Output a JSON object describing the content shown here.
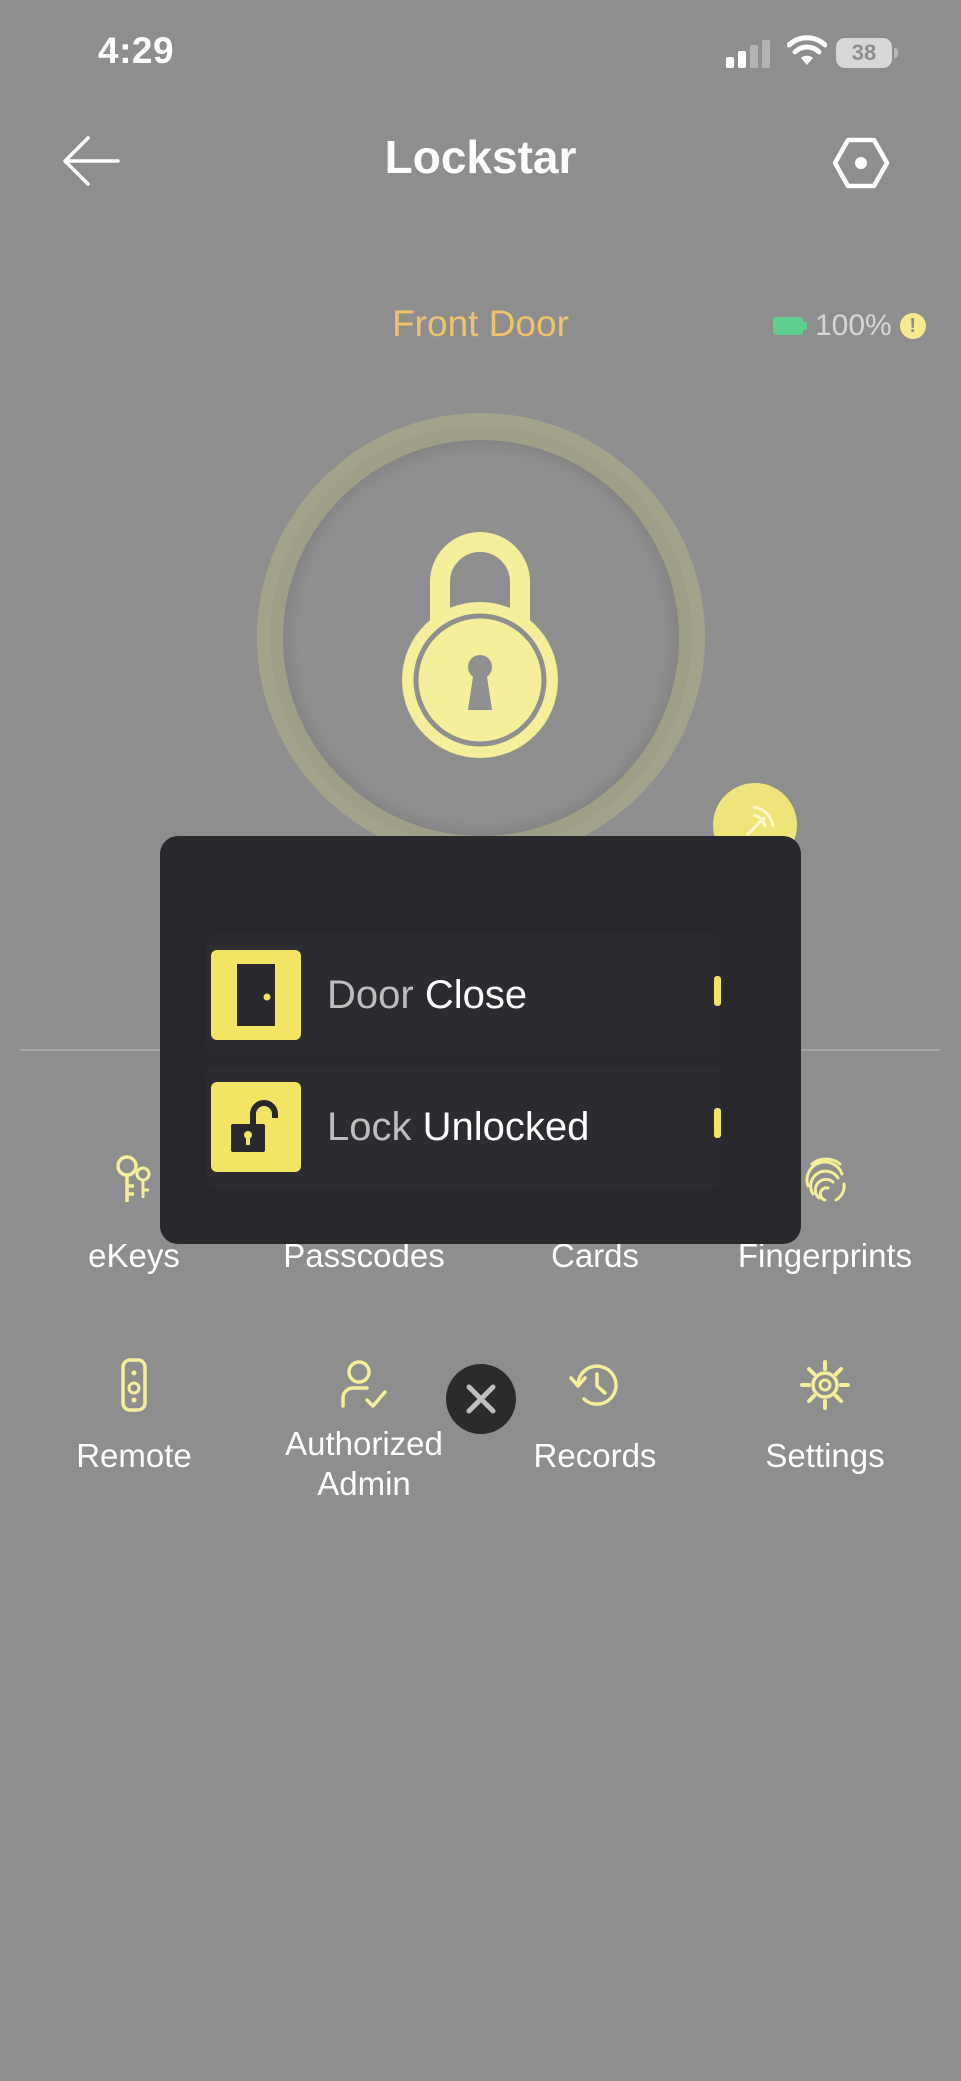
{
  "status_bar": {
    "time": "4:29",
    "battery_level": "38"
  },
  "nav": {
    "title": "Lockstar"
  },
  "lock": {
    "name": "Front Door",
    "battery_percent": "100%",
    "battery_warning": "!"
  },
  "popup": {
    "rows": [
      {
        "key": "Door",
        "value": "Close"
      },
      {
        "key": "Lock",
        "value": "Unlocked"
      }
    ]
  },
  "menu": {
    "row1": [
      {
        "label": "eKeys",
        "icon": "keys-icon"
      },
      {
        "label": "Passcodes",
        "icon": "passcode-icon"
      },
      {
        "label": "Cards",
        "icon": "card-icon"
      },
      {
        "label": "Fingerprints",
        "icon": "fingerprint-icon"
      }
    ],
    "row2": [
      {
        "label": "Remote",
        "icon": "remote-icon"
      },
      {
        "label": "Authorized Admin",
        "icon": "admin-icon"
      },
      {
        "label": "Records",
        "icon": "history-icon"
      },
      {
        "label": "Settings",
        "icon": "gear-icon"
      }
    ]
  },
  "colors": {
    "background": "#8e8e8e",
    "accent": "#f3e563",
    "door_name": "#f0c36a",
    "popup": "#28282d"
  }
}
